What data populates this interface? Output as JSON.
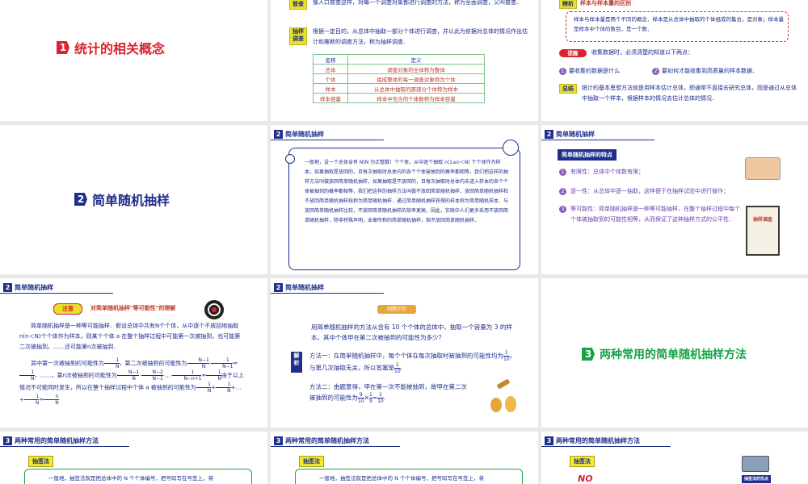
{
  "colors": {
    "navy": "#1f2f8a",
    "red": "#d9232e",
    "green": "#17a345",
    "yellow": "#f2ea2e",
    "purple": "#8a5fbf",
    "text": "#1c2a8c"
  },
  "s1": {
    "num": "1",
    "title": "统计的相关概念"
  },
  "s2": {
    "label_census": "普查",
    "census": "像人口普查这样，对每一个调查对象都进行调查的方法，称为全面调查，又叫普查．",
    "label_sample": "抽样调查",
    "sample": "根据一定目的，从总体中抽取一部分个体进行调查，并以此为依据对总体的情况作出估计和推断的调查方法，称为抽样调查．",
    "th_name": "名称",
    "th_def": "定义",
    "rows": [
      {
        "name": "总体",
        "def": "调查对象的全体称为整体"
      },
      {
        "name": "个体",
        "def": "组成整体的每一调查对象称为个体"
      },
      {
        "name": "样本",
        "def": "从总体中抽取的那部分个体称为样本"
      },
      {
        "name": "样本容量",
        "def": "样本中包含的个体数称为样本容量"
      }
    ]
  },
  "s3": {
    "label_analysis": "辨析",
    "analysis_title": "样本与样本量的区别",
    "analysis": "样本与样本量是两个不同的概念．样本是从总体中抽取的个体组成的集合，是对象；样本量是样本中个体的数目，是一个数．",
    "label_tip": "提醒",
    "tip": "收集数据时，必须清楚的知道以下两点：",
    "tip1": "要收集的数据是什么",
    "tip2": "要如何才能收集到高质量的样本数据．",
    "label_sum": "总结",
    "sum": "统计的基本思想方法就是用样本估计总体，即通常不直接去研究总体，而是通过从总体中抽取一个样本，根据样本的情况去估计总体的情况．"
  },
  "s4": {
    "num": "2",
    "title": "简单随机抽样"
  },
  "s5": {
    "num": "2",
    "header": "简单随机抽样",
    "body": "一般地，设一个总体含有 N(N 为正整数）个个体，从中逐个抽取 n(1≤n＜N) 个个体作为样本，如果抽取是放回的，且每次抽取时总体内的各个个体被抽到的概率都相等，我们把这样的抽样方法叫做放回简单随机抽样，如果抽取是不放回的，且每次抽取时总体内未进入样本的各个个体被抽到的概率都相等，我们把这样的抽样方法叫做不放回简单随机抽样．放回简单随机抽样和不放回简单随机抽样统称为简单随机抽样．通过简单随机抽样获得的样本称为简单随机样本．与放回简单随机抽样比较，不放回简单随机抽样的效率更高，因此，实践中人们更多采用不放回简单随机抽样，除非特殊声明，本章所称的简单随机抽样，指不放回简单随机抽样．"
  },
  "s6": {
    "num": "2",
    "header": "简单随机抽样",
    "feature_title": "简单随机抽样的特点",
    "f1": "有限性：总体中个体数有限；",
    "f2": "逐一性：从总体中逐一抽取，这样便于在抽样试验中进行操作；",
    "f3": "等可能性：简单随机抽样是一种等可能抽样，在整个抽样过程中每个个体被抽取到的可能性相等，从而保证了这种抽样方式的公平性．",
    "book": "抽样调查"
  },
  "s7": {
    "num": "2",
    "header": "简单随机抽样",
    "label_note": "注意",
    "note_title": "对简单随机抽样\"等可能性\"的理解",
    "p1": "简单随机抽样是一种等可能抽样．假设总体中共有N个个体，从中逐个不放回地抽取n(n＜N)个个体作为样本，则某个个体 a 在整个抽样过程中可能第一次被抽到，也可能第二次被抽到，……还可能第n次被抽到．",
    "p2a": "其中第一次被抽到的可能性为",
    "p2b": "，第二次被抽到的可能性为",
    "p3a": "，……，第n次被抽到的可能性为",
    "p3b": "由于以上情况不可能同时发生，所以在整个抽样过程中个体 a 被抽到的可能性为"
  },
  "s8": {
    "num": "2",
    "header": "简单随机抽样",
    "example_tag": "例题示范",
    "question": "用简单随机抽样的方法从含有 10 个个体的总体中，抽取一个容量为 3 的样本，其中个体甲在第二次被抽到的可能性为多少？",
    "label_sol": "解析",
    "m1a": "方法一：在简单随机抽样中，每个个体在每次抽取时被抽到的可能性均为",
    "m1b": "，与第几次抽取无关，所以答案是",
    "m2a": "方法二：由题意得，甲在第一次不能被抽到，故甲在第二次被抽到的可能性为"
  },
  "s9": {
    "num": "3",
    "title": "两种常用的简单随机抽样方法"
  },
  "s10": {
    "num": "3",
    "header": "两种常用的简单随机抽样方法",
    "tag": "抽签法",
    "body": "一般地，抽签法就是把总体中的 N 个个体编号，把号码写在号签上，将"
  },
  "s11": {
    "num": "3",
    "header": "两种常用的简单随机抽样方法",
    "tag": "抽签法",
    "body": "一般地，抽签法就是把总体中的 N 个个体编号，把号码写在号签上，将"
  },
  "s12": {
    "num": "3",
    "header": "两种常用的简单随机抽样方法",
    "tag": "抽签法",
    "badge": "NO",
    "sub": "抽签法的优点"
  }
}
